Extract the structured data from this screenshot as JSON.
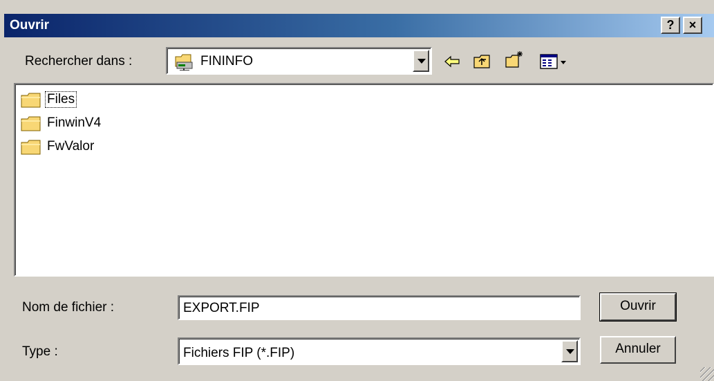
{
  "window": {
    "title": "Ouvrir",
    "help_label": "?",
    "close_label": "×"
  },
  "lookin": {
    "label": "Rechercher dans :",
    "value": "FININFO"
  },
  "toolbar": {
    "icons": [
      "back-arrow-icon",
      "up-folder-icon",
      "new-folder-icon",
      "view-menu-icon"
    ]
  },
  "files": [
    {
      "name": "Files",
      "focused": true
    },
    {
      "name": "FinwinV4",
      "focused": false
    },
    {
      "name": "FwValor",
      "focused": false
    }
  ],
  "filename": {
    "label": "Nom de fichier :",
    "value": "EXPORT.FIP"
  },
  "filetype": {
    "label": "Type :",
    "value": "Fichiers FIP (*.FIP)"
  },
  "buttons": {
    "open": "Ouvrir",
    "cancel": "Annuler"
  },
  "colors": {
    "titlebar_start": "#0a246a",
    "titlebar_end": "#a6caf0",
    "face": "#d4d0c8",
    "folder": "#f8d775"
  }
}
